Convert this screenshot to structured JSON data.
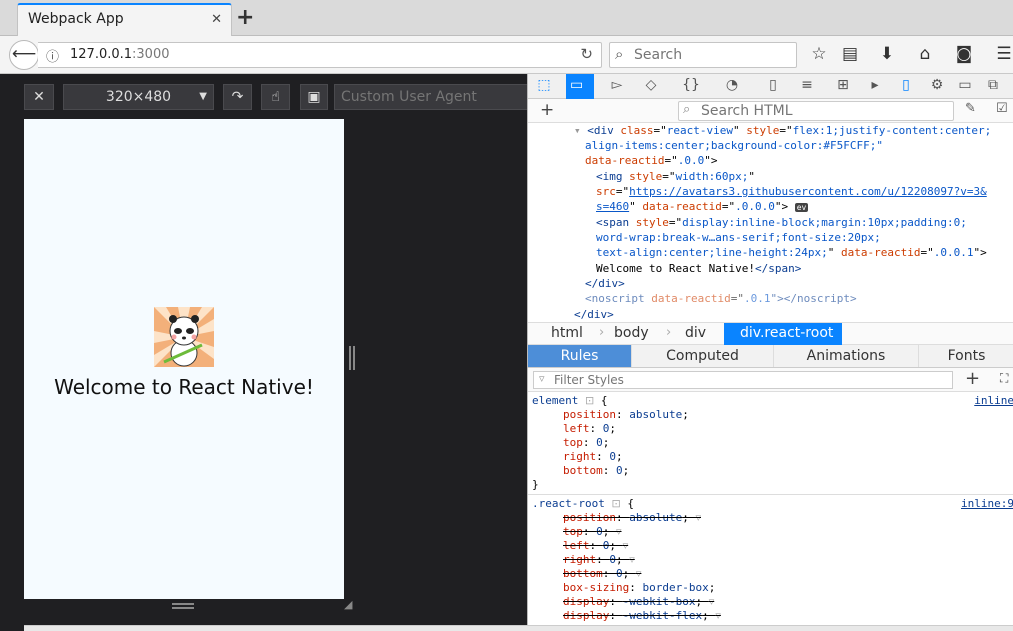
{
  "browser": {
    "tab_title": "Webpack App",
    "tab_close": "✕",
    "new_tab": "+",
    "url_host": "127.0.0.1",
    "url_port": ":3000",
    "search_placeholder": "Search"
  },
  "rdm": {
    "close_label": "✕",
    "device_size": "320×480",
    "ua_placeholder": "Custom User Agent",
    "welcome_text": "Welcome to React Native!"
  },
  "devtools": {
    "search_placeholder": "Search HTML",
    "markup": {
      "l1": {
        "a": "<div ",
        "b": "class",
        "c": "=\"",
        "d": "react-view",
        "e": "\" ",
        "f": "style",
        "g": "=\"",
        "h": "flex:1;justify-content:center;"
      },
      "l2": "align-items:center;background-color:#F5FCFF;\"",
      "l3": {
        "a": "data-reactid",
        "b": "=\"",
        "c": ".0.0",
        "d": "\">"
      },
      "l4": {
        "a": "<img ",
        "b": "style",
        "c": "=\"",
        "d": "width:60px;",
        "e": "\""
      },
      "l5": {
        "a": "src",
        "b": "=\"",
        "c": "https://avatars3.githubusercontent.com/u/12208097?v=3&"
      },
      "l6": {
        "a": "s=460",
        "b": "\" ",
        "c": "data-reactid",
        "d": "=\"",
        "e": ".0.0.0",
        "f": "\">",
        "g": "ev"
      },
      "l7": {
        "a": "<span ",
        "b": "style",
        "c": "=\"",
        "d": "display:inline-block;margin:10px;padding:0;"
      },
      "l8": "word-wrap:break-w…ans-serif;font-size:20px;",
      "l9": {
        "a": "text-align:center;line-height:24px;",
        "b": "\" ",
        "c": "data-reactid",
        "d": "=\"",
        "e": ".0.0.1",
        "f": "\">"
      },
      "l10": {
        "a": "Welcome to React Native!",
        "b": "</span>"
      },
      "l11": "</div>",
      "l12": {
        "a": "<noscript ",
        "b": "data-reactid",
        "c": "=\"",
        "d": ".0.1",
        "e": "\"></noscript>"
      },
      "l13": "</div>"
    },
    "breadcrumbs": [
      "html",
      "body",
      "div",
      "div.react-root"
    ],
    "tabs": [
      "Rules",
      "Computed",
      "Animations",
      "Fonts"
    ],
    "filter_placeholder": "Filter Styles",
    "rules": {
      "element": {
        "selector": "element",
        "source": "inline",
        "decls": [
          {
            "name": "position",
            "value": "absolute"
          },
          {
            "name": "left",
            "value": "0"
          },
          {
            "name": "top",
            "value": "0"
          },
          {
            "name": "right",
            "value": "0"
          },
          {
            "name": "bottom",
            "value": "0"
          }
        ]
      },
      "react_root": {
        "selector": ".react-root",
        "source": "inline:9",
        "decls": [
          {
            "name": "position",
            "value": "absolute"
          },
          {
            "name": "top",
            "value": "0"
          },
          {
            "name": "left",
            "value": "0"
          },
          {
            "name": "right",
            "value": "0"
          },
          {
            "name": "bottom",
            "value": "0"
          },
          {
            "name": "box-sizing",
            "value": "border-box"
          },
          {
            "name": "display",
            "value": "-webkit-box"
          },
          {
            "name": "display",
            "value": "-webkit-flex"
          }
        ]
      }
    }
  }
}
